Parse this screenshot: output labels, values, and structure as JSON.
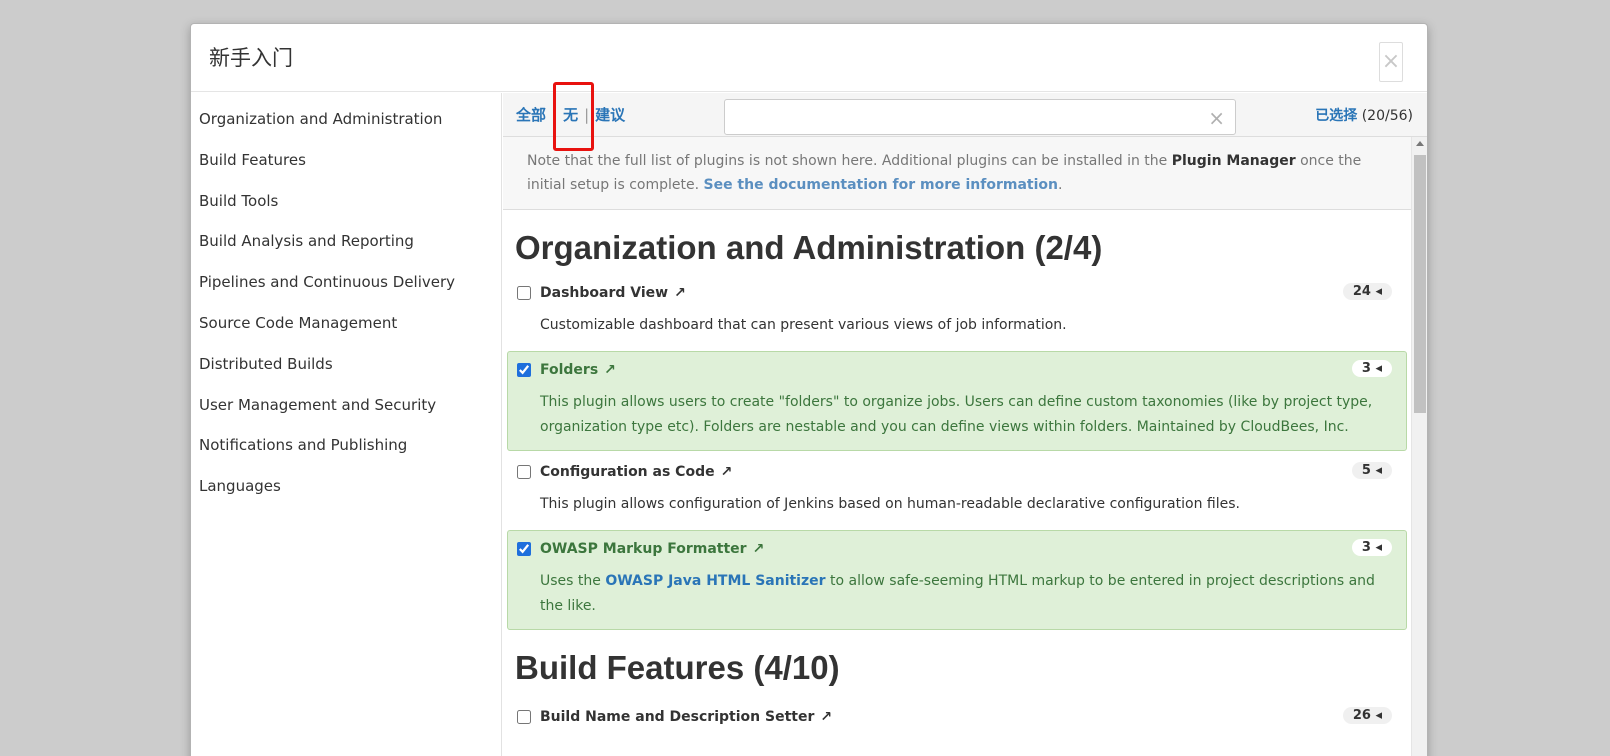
{
  "modal": {
    "title": "新手入门",
    "close_label": "×"
  },
  "sidebar": {
    "items": [
      {
        "label": "Organization and Administration"
      },
      {
        "label": "Build Features"
      },
      {
        "label": "Build Tools"
      },
      {
        "label": "Build Analysis and Reporting"
      },
      {
        "label": "Pipelines and Continuous Delivery"
      },
      {
        "label": "Source Code Management"
      },
      {
        "label": "Distributed Builds"
      },
      {
        "label": "User Management and Security"
      },
      {
        "label": "Notifications and Publishing"
      },
      {
        "label": "Languages"
      }
    ]
  },
  "toolbar": {
    "all_label": "全部",
    "none_label": "无",
    "suggested_label": "建议",
    "separator": "|",
    "search_value": "",
    "search_placeholder": "",
    "clear_label": "×",
    "selected_label": "已选择",
    "selected_count": "(20/56)"
  },
  "notice": {
    "text_before": "Note that the full list of plugins is not shown here. Additional plugins can be installed in the ",
    "plugin_manager": "Plugin Manager",
    "text_after": " once the initial setup is complete. ",
    "doc_link": "See the documentation for more information",
    "period": "."
  },
  "categories": [
    {
      "title": "Organization and Administration (2/4)",
      "plugins": [
        {
          "name": "Dashboard View",
          "ext": "↗",
          "deps": "24 ◂",
          "checked": false,
          "desc": "Customizable dashboard that can present various views of job information."
        },
        {
          "name": "Folders",
          "ext": "↗",
          "deps": "3 ◂",
          "checked": true,
          "desc": "This plugin allows users to create \"folders\" to organize jobs. Users can define custom taxonomies (like by project type, organization type etc). Folders are nestable and you can define views within folders. Maintained by CloudBees, Inc."
        },
        {
          "name": "Configuration as Code",
          "ext": "↗",
          "deps": "5 ◂",
          "checked": false,
          "desc": "This plugin allows configuration of Jenkins based on human-readable declarative configuration files."
        },
        {
          "name": "OWASP Markup Formatter",
          "ext": "↗",
          "deps": "3 ◂",
          "checked": true,
          "desc_before": "Uses the ",
          "desc_link": "OWASP Java HTML Sanitizer",
          "desc_after": " to allow safe-seeming HTML markup to be entered in project descriptions and the like."
        }
      ]
    },
    {
      "title": "Build Features (4/10)",
      "plugins": [
        {
          "name": "Build Name and Description Setter",
          "ext": "↗",
          "deps": "26 ◂",
          "checked": false
        }
      ]
    }
  ],
  "colors": {
    "link": "#2a75b7",
    "selected_bg": "#dff0d8",
    "selected_text": "#3c763d",
    "highlight": "#e8120f"
  }
}
